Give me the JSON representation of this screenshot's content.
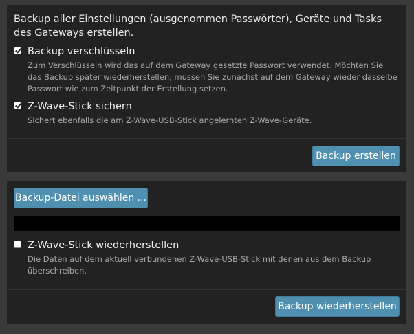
{
  "backup": {
    "intro": "Backup aller Einstellungen (ausgenommen Passwörter), Geräte und Tasks des Gateways erstellen.",
    "encrypt": {
      "label": "Backup verschlüsseln",
      "checked": true,
      "description": "Zum Verschlüsseln wird das auf dem Gateway gesetzte Passwort verwendet. Möchten Sie das Backup später wiederherstellen, müssen Sie zunächst auf dem Gateway wieder dasselbe Passwort wie zum Zeitpunkt der Erstellung setzen."
    },
    "zwave": {
      "label": "Z-Wave-Stick sichern",
      "checked": true,
      "description": "Sichert ebenfalls die am Z-Wave-USB-Stick angelernten Z-Wave-Geräte."
    },
    "create_button": "Backup erstellen"
  },
  "restore": {
    "select_file_button": "Backup-Datei auswählen ...",
    "file_name": "",
    "zwave": {
      "label": "Z-Wave-Stick wiederherstellen",
      "checked": false,
      "description": "Die Daten auf dem aktuell verbundenen Z-Wave-USB-Stick mit denen aus dem Backup überschreiben."
    },
    "restore_button": "Backup wiederherstellen"
  },
  "colors": {
    "page_background": "#3a3a3a",
    "panel_background": "#222222",
    "button_background": "#4f8fb0",
    "description_text": "#a8a8a8"
  }
}
